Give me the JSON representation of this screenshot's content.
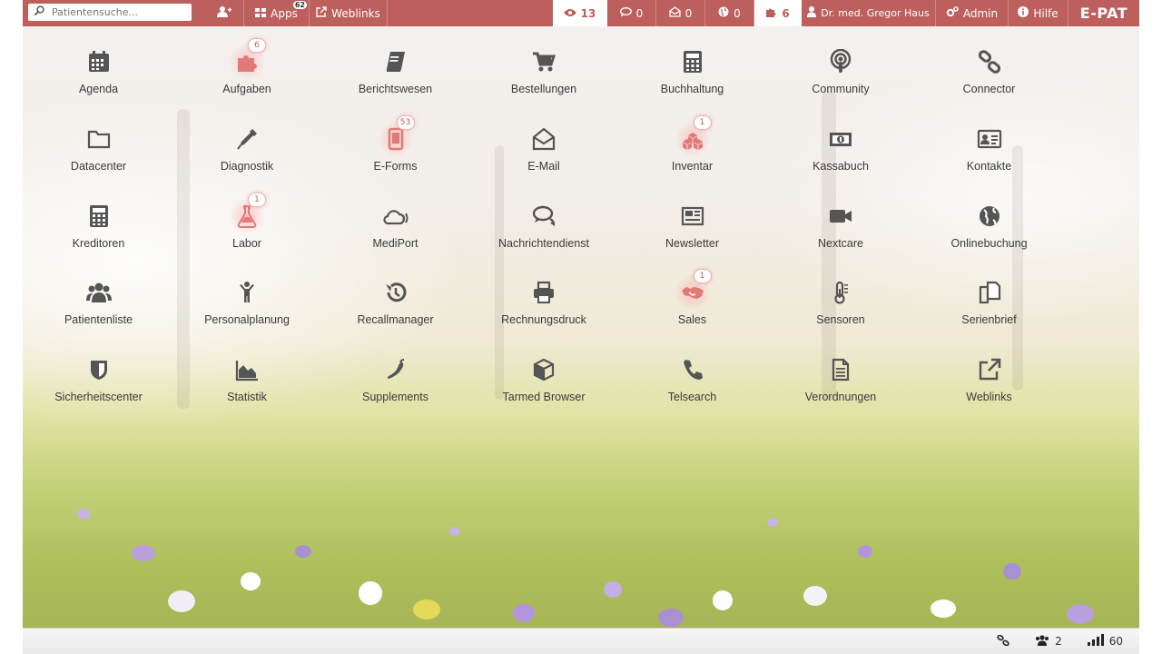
{
  "topbar": {
    "search_placeholder": "Patientensuche...",
    "apps_label": "Apps",
    "apps_badge": "62",
    "weblinks_label": "Weblinks",
    "views_count": "13",
    "chat_count": "0",
    "mail_count": "0",
    "globe_count": "0",
    "puzzle_count": "6",
    "user_label": "Dr. med. Gregor Haus",
    "admin_label": "Admin",
    "help_label": "Hilfe",
    "brand": "E-PAT"
  },
  "apps": [
    {
      "label": "Agenda",
      "icon": "calendar-icon",
      "badge": ""
    },
    {
      "label": "Aufgaben",
      "icon": "puzzle-icon",
      "badge": "6"
    },
    {
      "label": "Berichtswesen",
      "icon": "book-icon",
      "badge": ""
    },
    {
      "label": "Bestellungen",
      "icon": "cart-icon",
      "badge": ""
    },
    {
      "label": "Buchhaltung",
      "icon": "calculator-icon",
      "badge": ""
    },
    {
      "label": "Community",
      "icon": "podcast-icon",
      "badge": ""
    },
    {
      "label": "Connector",
      "icon": "link-icon",
      "badge": ""
    },
    {
      "label": "Datacenter",
      "icon": "folder-icon",
      "badge": ""
    },
    {
      "label": "Diagnostik",
      "icon": "eyedropper-icon",
      "badge": ""
    },
    {
      "label": "E-Forms",
      "icon": "tablet-icon",
      "badge": "53"
    },
    {
      "label": "E-Mail",
      "icon": "envelope-open-icon",
      "badge": ""
    },
    {
      "label": "Inventar",
      "icon": "cubes-icon",
      "badge": "1"
    },
    {
      "label": "Kassabuch",
      "icon": "money-icon",
      "badge": ""
    },
    {
      "label": "Kontakte",
      "icon": "id-card-icon",
      "badge": ""
    },
    {
      "label": "Kreditoren",
      "icon": "calculator-icon",
      "badge": ""
    },
    {
      "label": "Labor",
      "icon": "flask-icon",
      "badge": "1"
    },
    {
      "label": "MediPort",
      "icon": "cloud-signal-icon",
      "badge": ""
    },
    {
      "label": "Nachrichtendienst",
      "icon": "comments-icon",
      "badge": ""
    },
    {
      "label": "Newsletter",
      "icon": "newspaper-icon",
      "badge": ""
    },
    {
      "label": "Nextcare",
      "icon": "video-icon",
      "badge": ""
    },
    {
      "label": "Onlinebuchung",
      "icon": "globe-icon",
      "badge": ""
    },
    {
      "label": "Patientenliste",
      "icon": "users-icon",
      "badge": ""
    },
    {
      "label": "Personalplanung",
      "icon": "child-icon",
      "badge": ""
    },
    {
      "label": "Recallmanager",
      "icon": "history-icon",
      "badge": ""
    },
    {
      "label": "Rechnungsdruck",
      "icon": "print-icon",
      "badge": ""
    },
    {
      "label": "Sales",
      "icon": "handshake-icon",
      "badge": "1"
    },
    {
      "label": "Sensoren",
      "icon": "thermometer-icon",
      "badge": ""
    },
    {
      "label": "Serienbrief",
      "icon": "copy-icon",
      "badge": ""
    },
    {
      "label": "Sicherheitscenter",
      "icon": "shield-icon",
      "badge": ""
    },
    {
      "label": "Statistik",
      "icon": "area-chart-icon",
      "badge": ""
    },
    {
      "label": "Supplements",
      "icon": "pepper-icon",
      "badge": ""
    },
    {
      "label": "Tarmed Browser",
      "icon": "cube-icon",
      "badge": ""
    },
    {
      "label": "Telsearch",
      "icon": "phone-icon",
      "badge": ""
    },
    {
      "label": "Verordnungen",
      "icon": "document-icon",
      "badge": ""
    },
    {
      "label": "Weblinks",
      "icon": "external-link-icon",
      "badge": ""
    }
  ],
  "statusbar": {
    "users_count": "2",
    "signal_value": "60"
  },
  "colors": {
    "accent": "#bd5f5c",
    "icon": "#555555",
    "icon_highlight": "#e07a77"
  }
}
